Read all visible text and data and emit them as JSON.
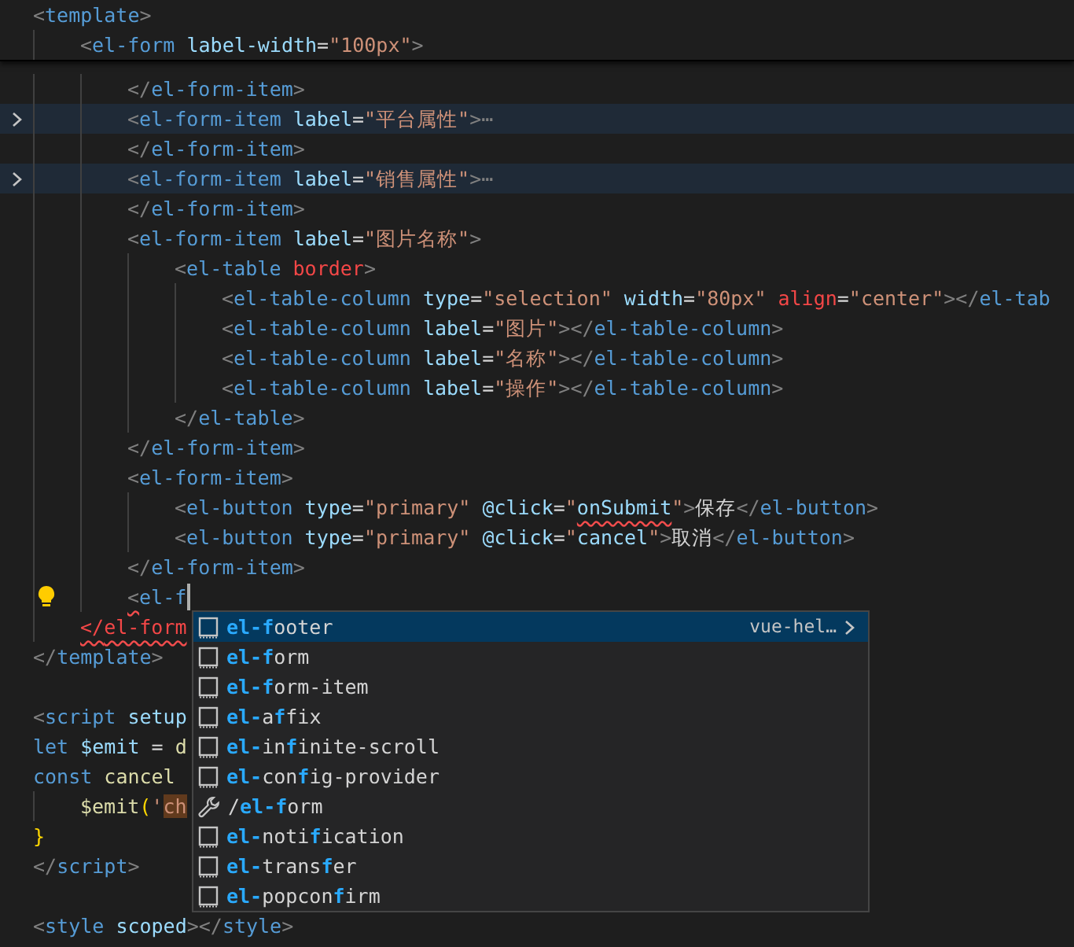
{
  "sticky_header": [
    {
      "tokens": [
        {
          "t": "<",
          "kind": "punct"
        },
        {
          "t": "template",
          "kind": "tag"
        },
        {
          "t": ">",
          "kind": "punct"
        }
      ],
      "children": [
        {
          "tokens": [
            {
              "t": "<",
              "kind": "punct"
            },
            {
              "t": "el-form",
              "kind": "tag"
            },
            {
              "t": " label-width",
              "kind": "attr"
            },
            {
              "t": "=",
              "kind": "op"
            },
            {
              "t": "\"100px\"",
              "kind": "str"
            },
            {
              "t": ">",
              "kind": "punct"
            }
          ]
        }
      ]
    }
  ],
  "lines": [
    {
      "children": [
        {
          "children": [
            {
              "tokens": [
                {
                  "t": "</",
                  "kind": "punct"
                },
                {
                  "t": "el-form-item",
                  "kind": "tag"
                },
                {
                  "t": ">",
                  "kind": "punct"
                }
              ]
            },
            {
              "folded": true,
              "tokens": [
                {
                  "t": "<",
                  "kind": "punct"
                },
                {
                  "t": "el-form-item",
                  "kind": "tag"
                },
                {
                  "t": " label",
                  "kind": "attr"
                },
                {
                  "t": "=",
                  "kind": "op"
                },
                {
                  "t": "\"平台属性\"",
                  "kind": "str"
                },
                {
                  "t": ">",
                  "kind": "punct"
                },
                {
                  "t": "⋯",
                  "kind": "punct"
                }
              ]
            },
            {
              "tokens": [
                {
                  "t": "</",
                  "kind": "punct"
                },
                {
                  "t": "el-form-item",
                  "kind": "tag"
                },
                {
                  "t": ">",
                  "kind": "punct"
                }
              ]
            },
            {
              "folded": true,
              "tokens": [
                {
                  "t": "<",
                  "kind": "punct"
                },
                {
                  "t": "el-form-item",
                  "kind": "tag"
                },
                {
                  "t": " label",
                  "kind": "attr"
                },
                {
                  "t": "=",
                  "kind": "op"
                },
                {
                  "t": "\"销售属性\"",
                  "kind": "str"
                },
                {
                  "t": ">",
                  "kind": "punct"
                },
                {
                  "t": "⋯",
                  "kind": "punct"
                }
              ]
            },
            {
              "tokens": [
                {
                  "t": "</",
                  "kind": "punct"
                },
                {
                  "t": "el-form-item",
                  "kind": "tag"
                },
                {
                  "t": ">",
                  "kind": "punct"
                }
              ]
            },
            {
              "tokens": [
                {
                  "t": "<",
                  "kind": "punct"
                },
                {
                  "t": "el-form-item",
                  "kind": "tag"
                },
                {
                  "t": " label",
                  "kind": "attr"
                },
                {
                  "t": "=",
                  "kind": "op"
                },
                {
                  "t": "\"图片名称\"",
                  "kind": "str"
                },
                {
                  "t": ">",
                  "kind": "punct"
                }
              ],
              "children": [
                {
                  "tokens": [
                    {
                      "t": "<",
                      "kind": "punct"
                    },
                    {
                      "t": "el-table",
                      "kind": "tag"
                    },
                    {
                      "t": " border",
                      "kind": "err"
                    },
                    {
                      "t": ">",
                      "kind": "punct"
                    }
                  ],
                  "children": [
                    {
                      "tokens": [
                        {
                          "t": "<",
                          "kind": "punct"
                        },
                        {
                          "t": "el-table-column",
                          "kind": "tag"
                        },
                        {
                          "t": " type",
                          "kind": "attr"
                        },
                        {
                          "t": "=",
                          "kind": "op"
                        },
                        {
                          "t": "\"selection\"",
                          "kind": "str"
                        },
                        {
                          "t": " width",
                          "kind": "attr"
                        },
                        {
                          "t": "=",
                          "kind": "op"
                        },
                        {
                          "t": "\"80px\"",
                          "kind": "str"
                        },
                        {
                          "t": " align",
                          "kind": "err"
                        },
                        {
                          "t": "=",
                          "kind": "op"
                        },
                        {
                          "t": "\"center\"",
                          "kind": "str"
                        },
                        {
                          "t": "></",
                          "kind": "punct"
                        },
                        {
                          "t": "el-tab",
                          "kind": "tag"
                        }
                      ]
                    },
                    {
                      "tokens": [
                        {
                          "t": "<",
                          "kind": "punct"
                        },
                        {
                          "t": "el-table-column",
                          "kind": "tag"
                        },
                        {
                          "t": " label",
                          "kind": "attr"
                        },
                        {
                          "t": "=",
                          "kind": "op"
                        },
                        {
                          "t": "\"图片\"",
                          "kind": "str"
                        },
                        {
                          "t": "></",
                          "kind": "punct"
                        },
                        {
                          "t": "el-table-column",
                          "kind": "tag"
                        },
                        {
                          "t": ">",
                          "kind": "punct"
                        }
                      ]
                    },
                    {
                      "tokens": [
                        {
                          "t": "<",
                          "kind": "punct"
                        },
                        {
                          "t": "el-table-column",
                          "kind": "tag"
                        },
                        {
                          "t": " label",
                          "kind": "attr"
                        },
                        {
                          "t": "=",
                          "kind": "op"
                        },
                        {
                          "t": "\"名称\"",
                          "kind": "str"
                        },
                        {
                          "t": "></",
                          "kind": "punct"
                        },
                        {
                          "t": "el-table-column",
                          "kind": "tag"
                        },
                        {
                          "t": ">",
                          "kind": "punct"
                        }
                      ]
                    },
                    {
                      "tokens": [
                        {
                          "t": "<",
                          "kind": "punct"
                        },
                        {
                          "t": "el-table-column",
                          "kind": "tag"
                        },
                        {
                          "t": " label",
                          "kind": "attr"
                        },
                        {
                          "t": "=",
                          "kind": "op"
                        },
                        {
                          "t": "\"操作\"",
                          "kind": "str"
                        },
                        {
                          "t": "></",
                          "kind": "punct"
                        },
                        {
                          "t": "el-table-column",
                          "kind": "tag"
                        },
                        {
                          "t": ">",
                          "kind": "punct"
                        }
                      ]
                    }
                  ]
                },
                {
                  "tokens": [
                    {
                      "t": "</",
                      "kind": "punct"
                    },
                    {
                      "t": "el-table",
                      "kind": "tag"
                    },
                    {
                      "t": ">",
                      "kind": "punct"
                    }
                  ]
                }
              ]
            },
            {
              "tokens": [
                {
                  "t": "</",
                  "kind": "punct"
                },
                {
                  "t": "el-form-item",
                  "kind": "tag"
                },
                {
                  "t": ">",
                  "kind": "punct"
                }
              ]
            },
            {
              "tokens": [
                {
                  "t": "<",
                  "kind": "punct"
                },
                {
                  "t": "el-form-item",
                  "kind": "tag"
                },
                {
                  "t": ">",
                  "kind": "punct"
                }
              ],
              "children": [
                {
                  "tokens": [
                    {
                      "t": "<",
                      "kind": "punct"
                    },
                    {
                      "t": "el-button",
                      "kind": "tag"
                    },
                    {
                      "t": " type",
                      "kind": "attr"
                    },
                    {
                      "t": "=",
                      "kind": "op"
                    },
                    {
                      "t": "\"primary\"",
                      "kind": "str"
                    },
                    {
                      "t": " @click",
                      "kind": "attr"
                    },
                    {
                      "t": "=",
                      "kind": "op"
                    },
                    {
                      "t": "\"",
                      "kind": "str"
                    },
                    {
                      "t": "onSubmit",
                      "kind": "attr",
                      "squiggle": true
                    },
                    {
                      "t": "\"",
                      "kind": "str"
                    },
                    {
                      "t": ">",
                      "kind": "punct"
                    },
                    {
                      "t": "保存",
                      "kind": "text"
                    },
                    {
                      "t": "</",
                      "kind": "punct"
                    },
                    {
                      "t": "el-button",
                      "kind": "tag"
                    },
                    {
                      "t": ">",
                      "kind": "punct"
                    }
                  ]
                },
                {
                  "tokens": [
                    {
                      "t": "<",
                      "kind": "punct"
                    },
                    {
                      "t": "el-button",
                      "kind": "tag"
                    },
                    {
                      "t": " type",
                      "kind": "attr"
                    },
                    {
                      "t": "=",
                      "kind": "op"
                    },
                    {
                      "t": "\"primary\"",
                      "kind": "str"
                    },
                    {
                      "t": " @click",
                      "kind": "attr"
                    },
                    {
                      "t": "=",
                      "kind": "op"
                    },
                    {
                      "t": "\"",
                      "kind": "str"
                    },
                    {
                      "t": "cancel",
                      "kind": "attr"
                    },
                    {
                      "t": "\"",
                      "kind": "str"
                    },
                    {
                      "t": ">",
                      "kind": "punct"
                    },
                    {
                      "t": "取消",
                      "kind": "text"
                    },
                    {
                      "t": "</",
                      "kind": "punct"
                    },
                    {
                      "t": "el-button",
                      "kind": "tag"
                    },
                    {
                      "t": ">",
                      "kind": "punct"
                    }
                  ]
                }
              ]
            },
            {
              "tokens": [
                {
                  "t": "</",
                  "kind": "punct"
                },
                {
                  "t": "el-form-item",
                  "kind": "tag"
                },
                {
                  "t": ">",
                  "kind": "punct"
                }
              ]
            },
            {
              "lightbulb": true,
              "cursor": true,
              "tokens": [
                {
                  "t": "<",
                  "kind": "punct",
                  "squiggle": true
                },
                {
                  "t": "el-f",
                  "kind": "tag"
                }
              ]
            }
          ]
        },
        {
          "tokens": [
            {
              "t": "</",
              "kind": "errtag",
              "squiggle": true
            },
            {
              "t": "el-form",
              "kind": "errtag",
              "squiggle": true
            }
          ]
        }
      ]
    },
    {
      "tokens": [
        {
          "t": "</",
          "kind": "punct"
        },
        {
          "t": "template",
          "kind": "tag"
        },
        {
          "t": ">",
          "kind": "punct"
        }
      ]
    },
    {
      "kind": "blank"
    },
    {
      "tokens": [
        {
          "t": "<",
          "kind": "punct"
        },
        {
          "t": "script",
          "kind": "tag"
        },
        {
          "t": " setup",
          "kind": "attr"
        }
      ]
    },
    {
      "tokens": [
        {
          "t": "let",
          "kind": "kw"
        },
        {
          "t": " $emit",
          "kind": "var"
        },
        {
          "t": " = ",
          "kind": "op"
        },
        {
          "t": "d",
          "kind": "fn"
        }
      ]
    },
    {
      "tokens": [
        {
          "t": "const",
          "kind": "kw"
        },
        {
          "t": " cancel ",
          "kind": "fn"
        }
      ],
      "children": [
        {
          "tokens": [
            {
              "t": "$emit",
              "kind": "fn"
            },
            {
              "t": "(",
              "kind": "bracket"
            },
            {
              "t": "'",
              "kind": "str"
            },
            {
              "t": "ch",
              "kind": "str",
              "match": true
            }
          ]
        }
      ]
    },
    {
      "tokens": [
        {
          "t": "}",
          "kind": "bracket"
        }
      ]
    },
    {
      "tokens": [
        {
          "t": "</",
          "kind": "punct"
        },
        {
          "t": "script",
          "kind": "tag"
        },
        {
          "t": ">",
          "kind": "punct"
        }
      ]
    },
    {
      "kind": "blank"
    },
    {
      "tokens": [
        {
          "t": "<",
          "kind": "punct"
        },
        {
          "t": "style",
          "kind": "tag"
        },
        {
          "t": " scoped",
          "kind": "attr"
        },
        {
          "t": "></",
          "kind": "punct"
        },
        {
          "t": "style",
          "kind": "tag"
        },
        {
          "t": ">",
          "kind": "punct"
        }
      ]
    }
  ],
  "suggestions": [
    {
      "kind": "tag",
      "selected": true,
      "detail": "vue-hel…",
      "parts": [
        {
          "t": "el-f",
          "m": true
        },
        {
          "t": "ooter",
          "m": false
        }
      ]
    },
    {
      "kind": "tag",
      "selected": false,
      "parts": [
        {
          "t": "el-f",
          "m": true
        },
        {
          "t": "orm",
          "m": false
        }
      ]
    },
    {
      "kind": "tag",
      "selected": false,
      "parts": [
        {
          "t": "el-f",
          "m": true
        },
        {
          "t": "orm-item",
          "m": false
        }
      ]
    },
    {
      "kind": "tag",
      "selected": false,
      "parts": [
        {
          "t": "el-",
          "m": true
        },
        {
          "t": "a",
          "m": false
        },
        {
          "t": "f",
          "m": true
        },
        {
          "t": "fix",
          "m": false
        }
      ]
    },
    {
      "kind": "tag",
      "selected": false,
      "parts": [
        {
          "t": "el-",
          "m": true
        },
        {
          "t": "in",
          "m": false
        },
        {
          "t": "f",
          "m": true
        },
        {
          "t": "inite-scroll",
          "m": false
        }
      ]
    },
    {
      "kind": "tag",
      "selected": false,
      "parts": [
        {
          "t": "el-",
          "m": true
        },
        {
          "t": "con",
          "m": false
        },
        {
          "t": "f",
          "m": true
        },
        {
          "t": "ig-provider",
          "m": false
        }
      ]
    },
    {
      "kind": "snippet",
      "selected": false,
      "parts": [
        {
          "t": "/",
          "m": false
        },
        {
          "t": "el-f",
          "m": true
        },
        {
          "t": "orm",
          "m": false
        }
      ]
    },
    {
      "kind": "tag",
      "selected": false,
      "parts": [
        {
          "t": "el-",
          "m": true
        },
        {
          "t": "noti",
          "m": false
        },
        {
          "t": "f",
          "m": true
        },
        {
          "t": "ication",
          "m": false
        }
      ]
    },
    {
      "kind": "tag",
      "selected": false,
      "parts": [
        {
          "t": "el-",
          "m": true
        },
        {
          "t": "trans",
          "m": false
        },
        {
          "t": "f",
          "m": true
        },
        {
          "t": "er",
          "m": false
        }
      ]
    },
    {
      "kind": "tag",
      "selected": false,
      "parts": [
        {
          "t": "el-",
          "m": true
        },
        {
          "t": "popcon",
          "m": false
        },
        {
          "t": "f",
          "m": true
        },
        {
          "t": "irm",
          "m": false
        }
      ]
    }
  ]
}
